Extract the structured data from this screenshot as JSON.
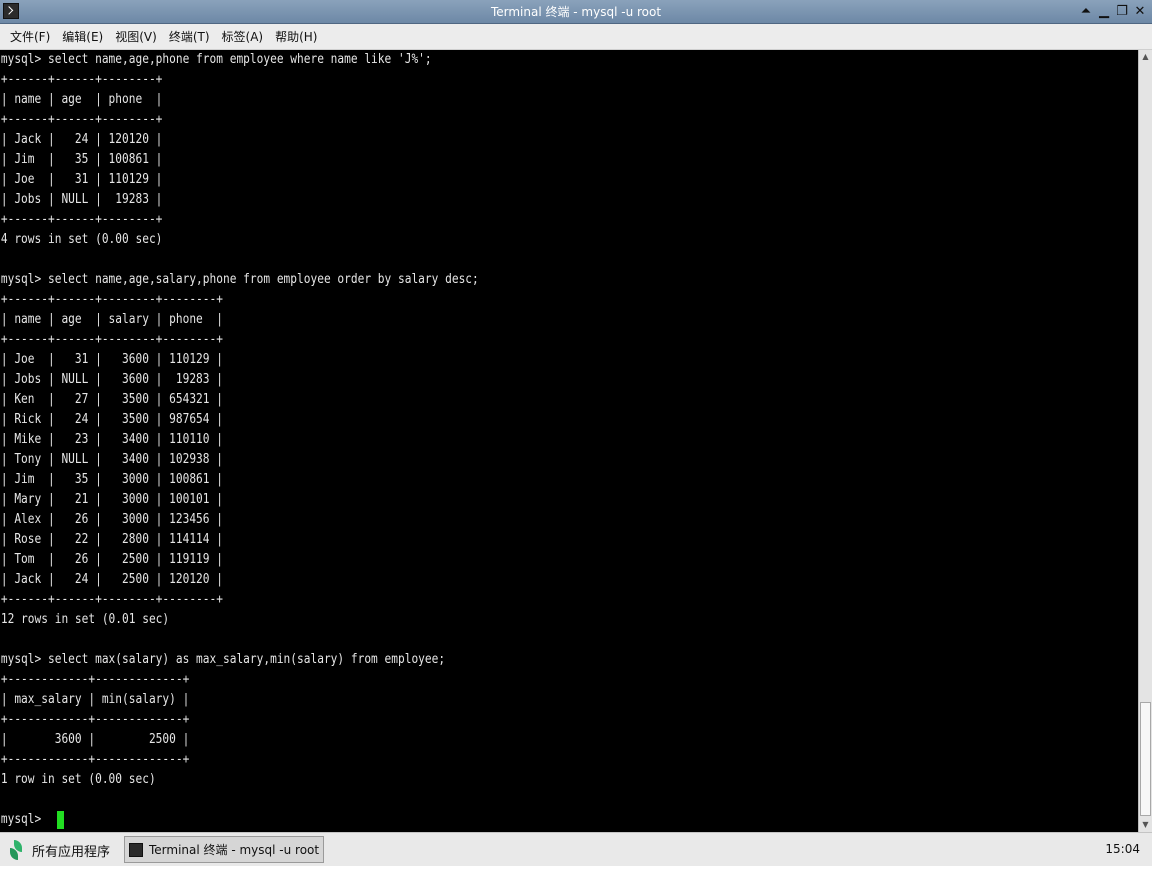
{
  "window": {
    "title": "Terminal 终端 - mysql -u root",
    "controls": [
      "⏶",
      "▁",
      "❐",
      "✕"
    ]
  },
  "menu": [
    {
      "label": "文件(F)"
    },
    {
      "label": "编辑(E)"
    },
    {
      "label": "视图(V)"
    },
    {
      "label": "终端(T)"
    },
    {
      "label": "标签(A)"
    },
    {
      "label": "帮助(H)"
    }
  ],
  "terminal": {
    "lines": [
      "mysql> select name,age,phone from employee where name like 'J%';",
      "+------+------+--------+",
      "| name | age  | phone  |",
      "+------+------+--------+",
      "| Jack |   24 | 120120 |",
      "| Jim  |   35 | 100861 |",
      "| Joe  |   31 | 110129 |",
      "| Jobs | NULL |  19283 |",
      "+------+------+--------+",
      "4 rows in set (0.00 sec)",
      "",
      "mysql> select name,age,salary,phone from employee order by salary desc;",
      "+------+------+--------+--------+",
      "| name | age  | salary | phone  |",
      "+------+------+--------+--------+",
      "| Joe  |   31 |   3600 | 110129 |",
      "| Jobs | NULL |   3600 |  19283 |",
      "| Ken  |   27 |   3500 | 654321 |",
      "| Rick |   24 |   3500 | 987654 |",
      "| Mike |   23 |   3400 | 110110 |",
      "| Tony | NULL |   3400 | 102938 |",
      "| Jim  |   35 |   3000 | 100861 |",
      "| Mary |   21 |   3000 | 100101 |",
      "| Alex |   26 |   3000 | 123456 |",
      "| Rose |   22 |   2800 | 114114 |",
      "| Tom  |   26 |   2500 | 119119 |",
      "| Jack |   24 |   2500 | 120120 |",
      "+------+------+--------+--------+",
      "12 rows in set (0.01 sec)",
      "",
      "mysql> select max(salary) as max_salary,min(salary) from employee;",
      "+------------+-------------+",
      "| max_salary | min(salary) |",
      "+------------+-------------+",
      "|       3600 |        2500 |",
      "+------------+-------------+",
      "1 row in set (0.00 sec)",
      "",
      "mysql> "
    ],
    "cursor_color": "#22dd22"
  },
  "taskbar": {
    "start_label": "所有应用程序",
    "task_label": "Terminal 终端 - mysql -u root",
    "clock": "15:04"
  }
}
